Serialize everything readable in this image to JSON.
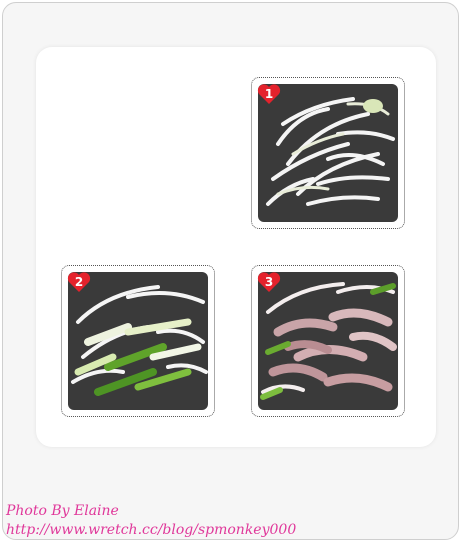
{
  "steps": [
    {
      "number": "1",
      "description": "sliced onions in pan"
    },
    {
      "number": "2",
      "description": "onions with green onion segments"
    },
    {
      "number": "3",
      "description": "onions, green onion and sliced pork"
    }
  ],
  "credit": {
    "line1": "Photo By Elaine",
    "line2": "http://www.wretch.cc/blog/spmonkey000"
  },
  "colors": {
    "badge": "#e4222c",
    "credit_text": "#e0389a",
    "pan": "#3a3a3a"
  }
}
